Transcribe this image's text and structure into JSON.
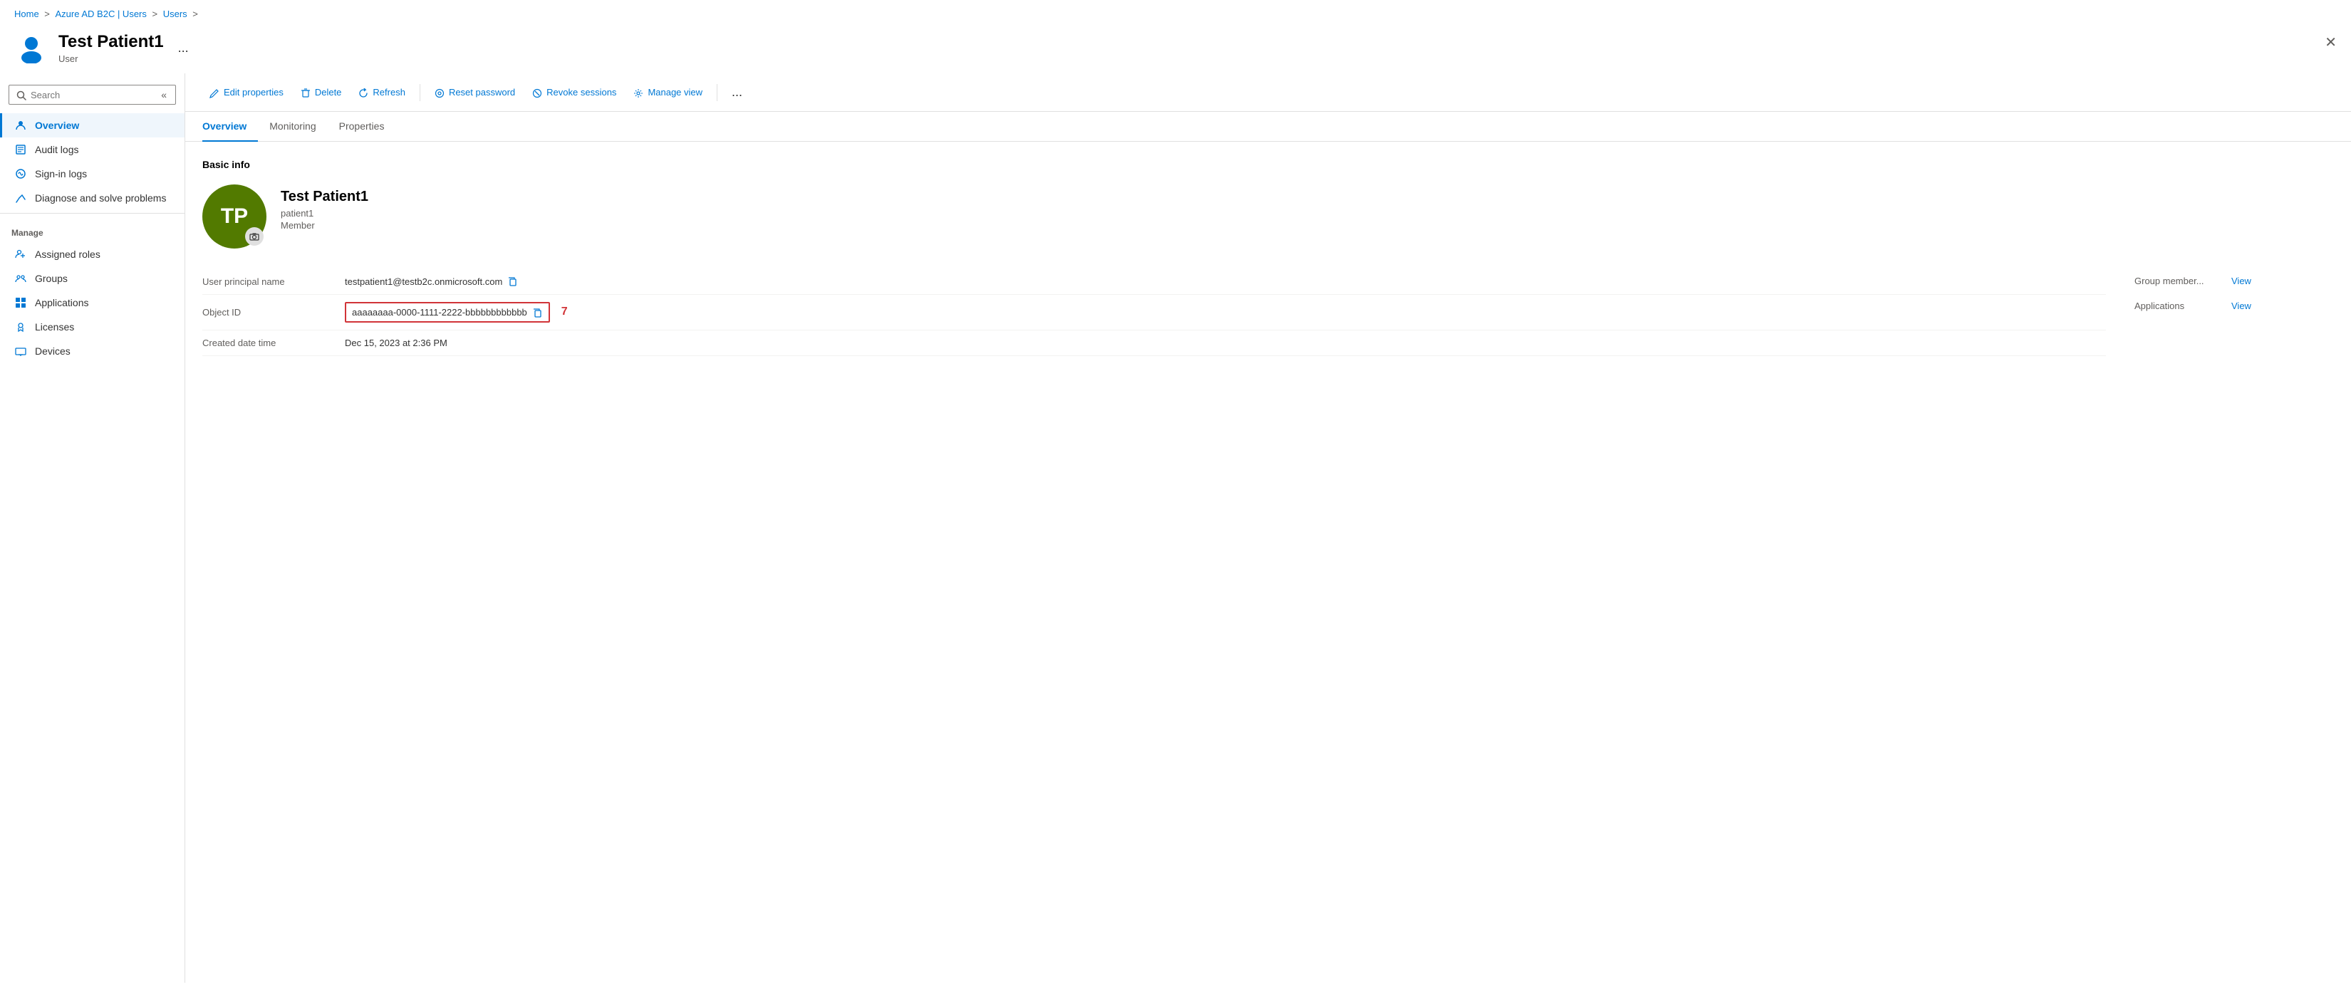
{
  "breadcrumb": {
    "items": [
      "Home",
      "Azure AD B2C | Users",
      "Users"
    ],
    "separator": ">"
  },
  "page_header": {
    "title": "Test Patient1",
    "subtitle": "User",
    "avatar_initials": "TP",
    "ellipsis_label": "...",
    "close_label": "✕"
  },
  "sidebar": {
    "search_placeholder": "Search",
    "collapse_icon": "«",
    "nav_items": [
      {
        "id": "overview",
        "label": "Overview",
        "active": true,
        "icon": "user"
      },
      {
        "id": "audit-logs",
        "label": "Audit logs",
        "active": false,
        "icon": "audit"
      },
      {
        "id": "sign-in-logs",
        "label": "Sign-in logs",
        "active": false,
        "icon": "signin"
      },
      {
        "id": "diagnose",
        "label": "Diagnose and solve problems",
        "active": false,
        "icon": "diagnose"
      }
    ],
    "manage_label": "Manage",
    "manage_items": [
      {
        "id": "assigned-roles",
        "label": "Assigned roles",
        "icon": "roles"
      },
      {
        "id": "groups",
        "label": "Groups",
        "icon": "groups"
      },
      {
        "id": "applications",
        "label": "Applications",
        "icon": "apps"
      },
      {
        "id": "licenses",
        "label": "Licenses",
        "icon": "licenses"
      },
      {
        "id": "devices",
        "label": "Devices",
        "icon": "devices"
      }
    ]
  },
  "toolbar": {
    "edit_label": "Edit properties",
    "delete_label": "Delete",
    "refresh_label": "Refresh",
    "reset_password_label": "Reset password",
    "revoke_sessions_label": "Revoke sessions",
    "manage_view_label": "Manage view",
    "more_label": "..."
  },
  "tabs": {
    "items": [
      "Overview",
      "Monitoring",
      "Properties"
    ],
    "active": "Overview"
  },
  "content": {
    "basic_info_label": "Basic info",
    "user_avatar_initials": "TP",
    "user_name": "Test Patient1",
    "user_email": "patient1",
    "user_role": "Member",
    "camera_icon": "📷",
    "fields": [
      {
        "label": "User principal name",
        "value": "testpatient1@testb2c.onmicrosoft.com",
        "has_copy": true,
        "highlighted": false
      },
      {
        "label": "Object ID",
        "value": "aaaaaaaa-0000-1111-2222-bbbbbbbbbbbb",
        "has_copy": true,
        "highlighted": true,
        "badge": "7"
      },
      {
        "label": "Created date time",
        "value": "Dec 15, 2023 at 2:36 PM",
        "has_copy": false,
        "highlighted": false
      }
    ],
    "side_fields": [
      {
        "label": "Group member...",
        "link_label": "View"
      },
      {
        "label": "Applications",
        "link_label": "View"
      }
    ]
  },
  "colors": {
    "accent": "#0078d4",
    "danger": "#d13438",
    "avatar_bg": "#527a00"
  }
}
